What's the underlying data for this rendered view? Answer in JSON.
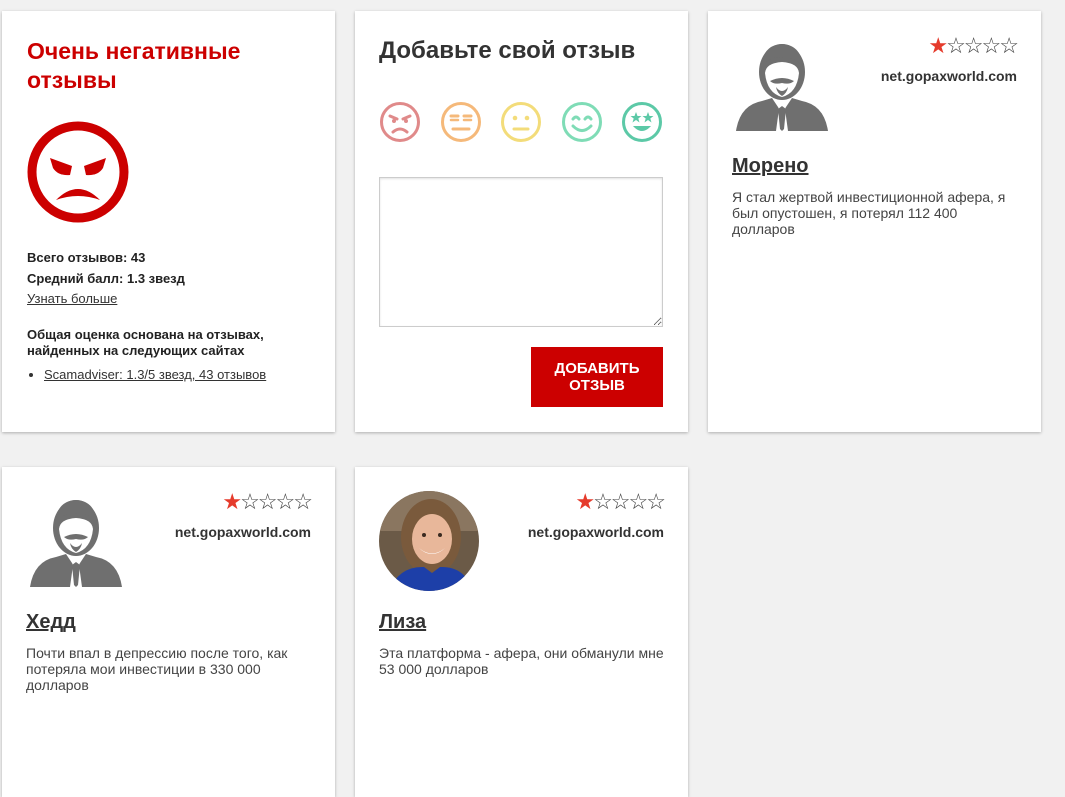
{
  "summary": {
    "title": "Очень негативные отзывы",
    "total_reviews": "Всего отзывов: 43",
    "average_score": "Средний балл: 1.3 звезд",
    "learn_more": "Узнать больше",
    "based_on": "Общая оценка основана на отзывах, найденных на следующих сайтах",
    "sources": [
      "Scamadviser: 1.3/5 звезд, 43 отзывов"
    ],
    "accent_color": "#cc0000",
    "icon": "angry-face-icon"
  },
  "add_review": {
    "title": "Добавьте свой отзыв",
    "emojis": [
      {
        "name": "angry-emoji-icon",
        "color": "#e08a8a"
      },
      {
        "name": "unamused-emoji-icon",
        "color": "#f5b97a"
      },
      {
        "name": "neutral-emoji-icon",
        "color": "#f3dc7a"
      },
      {
        "name": "smile-emoji-icon",
        "color": "#7fdcb6"
      },
      {
        "name": "star-eyes-emoji-icon",
        "color": "#5cc9a7"
      }
    ],
    "textarea_value": "",
    "button_label": "ДОБАВИТЬ ОТЗЫВ",
    "button_color": "#cc0000"
  },
  "reviews": [
    {
      "rating": 1,
      "max_rating": 5,
      "site": "net.gopaxworld.com",
      "name": "Морено",
      "text": "Я стал жертвой инвестиционной афера, я был опустошен, я потерял 112 400 долларов",
      "avatar": "default-man-icon"
    },
    {
      "rating": 1,
      "max_rating": 5,
      "site": "net.gopaxworld.com",
      "name": "Хедд",
      "text": "Почти впал в депрессию после того, как потеряла мои инвестиции в 330 000 долларов",
      "avatar": "default-man-icon"
    },
    {
      "rating": 1,
      "max_rating": 5,
      "site": "net.gopaxworld.com",
      "name": "Лиза",
      "text": "Эта платформа - афера, они обманули мне 53 000 долларов",
      "avatar": "woman-photo"
    }
  ],
  "star_color": "#e53b2c"
}
